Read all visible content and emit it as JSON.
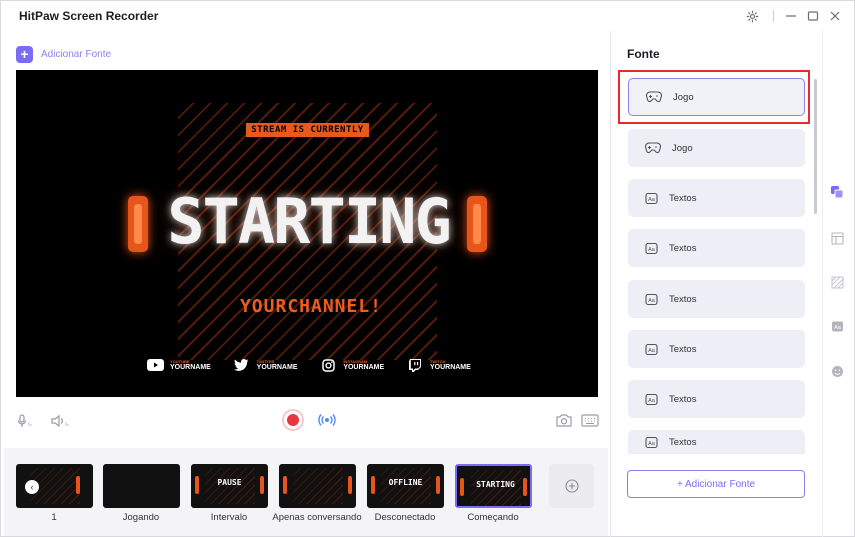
{
  "app": {
    "title": "HitPaw Screen Recorder"
  },
  "toolbar": {
    "add_source_label": "Adicionar Fonte"
  },
  "preview": {
    "tag": "STREAM IS CURRENTLY",
    "headline": "STARTING",
    "channel": "YOURCHANNEL!",
    "socials": [
      {
        "network": "YOUTUBE",
        "name": "YOURNAME",
        "icon": "youtube-icon"
      },
      {
        "network": "TWITTER",
        "name": "YOURNAME",
        "icon": "twitter-icon"
      },
      {
        "network": "INSTAGRAM",
        "name": "YOURNAME",
        "icon": "instagram-icon"
      },
      {
        "network": "TWITCH",
        "name": "YOURNAME",
        "icon": "twitch-icon"
      }
    ]
  },
  "scenes": [
    {
      "label": "1",
      "thumb_text": ""
    },
    {
      "label": "Jogando",
      "thumb_text": ""
    },
    {
      "label": "Intervalo",
      "thumb_text": "PAUSE"
    },
    {
      "label": "Apenas conversando",
      "thumb_text": ""
    },
    {
      "label": "Desconectado",
      "thumb_text": "OFFLINE"
    },
    {
      "label": "Começando",
      "thumb_text": "STARTING"
    }
  ],
  "panel": {
    "title": "Fonte",
    "sources": [
      {
        "label": "Jogo",
        "icon": "gamepad-icon"
      },
      {
        "label": "Jogo",
        "icon": "gamepad-icon"
      },
      {
        "label": "Textos",
        "icon": "text-icon"
      },
      {
        "label": "Textos",
        "icon": "text-icon"
      },
      {
        "label": "Textos",
        "icon": "text-icon"
      },
      {
        "label": "Textos",
        "icon": "text-icon"
      },
      {
        "label": "Textos",
        "icon": "text-icon"
      },
      {
        "label": "Textos",
        "icon": "text-icon"
      }
    ],
    "add_button_label": "+ Adicionar Fonte"
  },
  "colors": {
    "accent": "#7b6cf6",
    "record": "#e8363f",
    "highlight": "#e52b2b",
    "brand_orange": "#e85a1c"
  }
}
